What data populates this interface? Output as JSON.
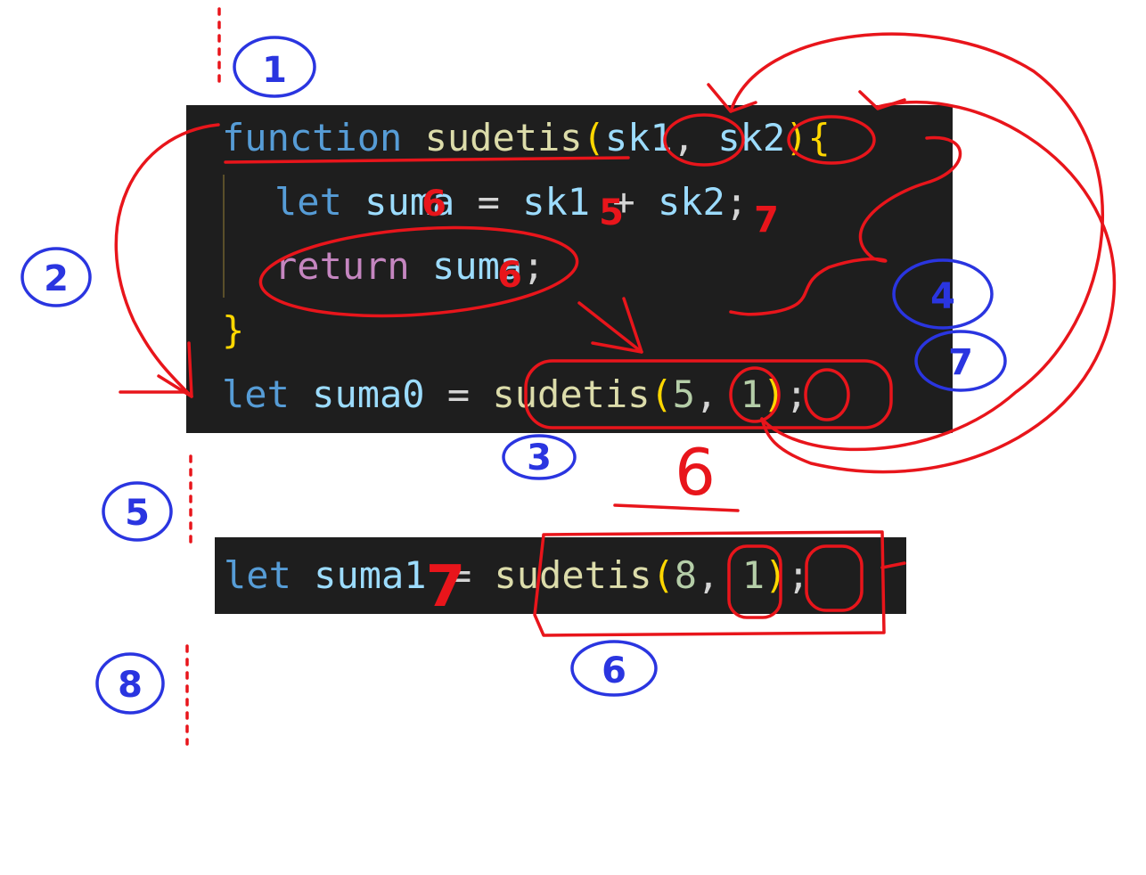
{
  "top_snippet": {
    "line1": {
      "kw": "function",
      "fn": "sudetis",
      "open_paren": "(",
      "p1": "sk1",
      "comma": ",",
      "p2": "sk2",
      "close_paren": ")",
      "brace": "{"
    },
    "line2": {
      "kw": "let",
      "var": "suma",
      "op_eq": "=",
      "a": "sk1",
      "op_plus": "+",
      "b": "sk2",
      "semi": ";"
    },
    "line3": {
      "kw": "return",
      "var": "suma",
      "semi": ";"
    },
    "line4": {
      "brace": "}"
    },
    "line5": {
      "kw": "let",
      "var": "suma0",
      "op_eq": "=",
      "fn": "sudetis",
      "open_paren": "(",
      "arg1": "5",
      "comma": ",",
      "arg2": "1",
      "close_paren": ")",
      "semi": ";"
    }
  },
  "bottom_snippet": {
    "kw": "let",
    "var": "suma1",
    "op_eq": "=",
    "fn": "sudetis",
    "open_paren": "(",
    "arg1": "8",
    "comma": ",",
    "arg2": "1",
    "close_paren": ")",
    "semi": ";"
  },
  "annotations": {
    "blue_labels": [
      "1",
      "2",
      "3",
      "4",
      "5",
      "6",
      "7",
      "8"
    ],
    "red_labels": [
      "5",
      "6",
      "7",
      "6",
      "5",
      "6",
      "7"
    ],
    "colors": {
      "blue_ink": "#2a35e0",
      "red_ink": "#e8151b"
    }
  },
  "theme": {
    "background": "#1e1e1e",
    "keyword": "#569cd6",
    "control_keyword": "#c586c0",
    "function": "#dcdcaa",
    "variable": "#9cdcfe",
    "number": "#b5cea8",
    "punctuation": "#d4d4d4"
  }
}
